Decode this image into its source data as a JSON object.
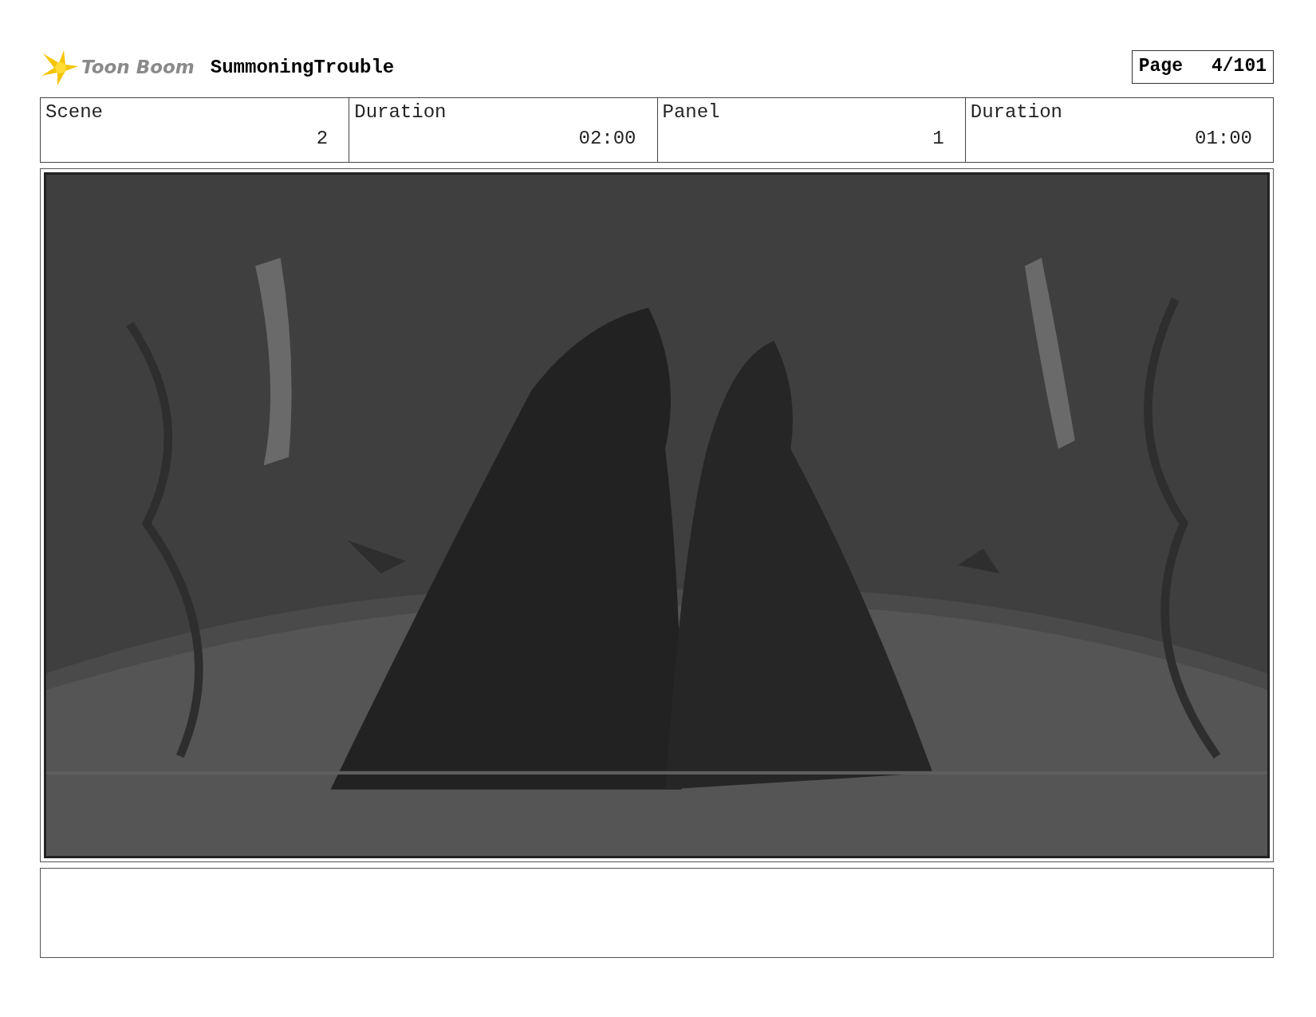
{
  "header": {
    "logo_text": "Toon Boom",
    "project": "SummoningTrouble",
    "page_label": "Page",
    "page_number": "4/101"
  },
  "fields": [
    {
      "label": "Scene",
      "value": "2"
    },
    {
      "label": "Duration",
      "value": "02:00"
    },
    {
      "label": "Panel",
      "value": "1"
    },
    {
      "label": "Duration",
      "value": "01:00"
    }
  ]
}
